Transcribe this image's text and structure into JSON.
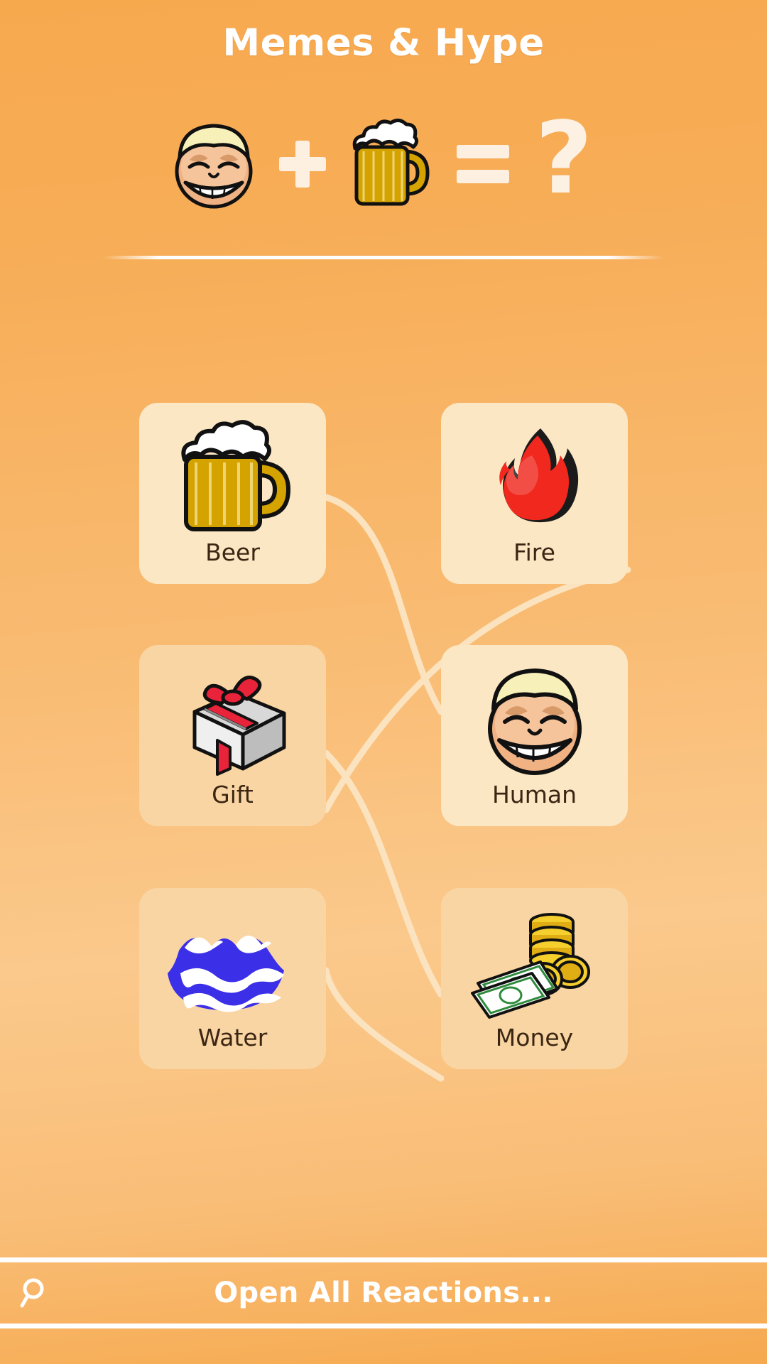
{
  "header": {
    "title": "Memes & Hype",
    "equation": {
      "left_icon": "human-face-icon",
      "operator_plus": "+",
      "right_icon": "beer-mug-icon",
      "operator_equals": "=",
      "result": "?"
    }
  },
  "grid": {
    "cards": [
      {
        "label": "Beer",
        "icon": "beer-mug-icon",
        "style": "bright"
      },
      {
        "label": "Fire",
        "icon": "fire-flame-icon",
        "style": "bright"
      },
      {
        "label": "Gift",
        "icon": "gift-box-icon",
        "style": "dim"
      },
      {
        "label": "Human",
        "icon": "human-face-icon",
        "style": "bright"
      },
      {
        "label": "Water",
        "icon": "water-waves-icon",
        "style": "dim"
      },
      {
        "label": "Money",
        "icon": "money-coins-icon",
        "style": "dim"
      }
    ]
  },
  "bottom_bar": {
    "search_icon": "magnifier-icon",
    "open_all_label": "Open All Reactions..."
  },
  "colors": {
    "background_top": "#f7a94e",
    "background_mid": "#fbc98c",
    "card_bright": "#fbe7c4",
    "card_dim": "#f9d5a3",
    "label_text": "#3b2613",
    "header_text": "#ffffff",
    "operator": "#fdf0e1",
    "connector": "#fbe3bf"
  }
}
